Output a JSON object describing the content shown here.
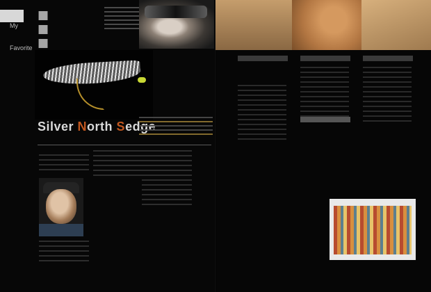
{
  "left_page": {
    "corner": {
      "label_top": "My",
      "label_bottom": "Favorite"
    },
    "title": {
      "main_part1": "Silver ",
      "main_part2": "N",
      "main_part3": "orth ",
      "main_part4": "S",
      "main_part5": "edge"
    }
  },
  "right_page": {
    "columns": 3
  }
}
